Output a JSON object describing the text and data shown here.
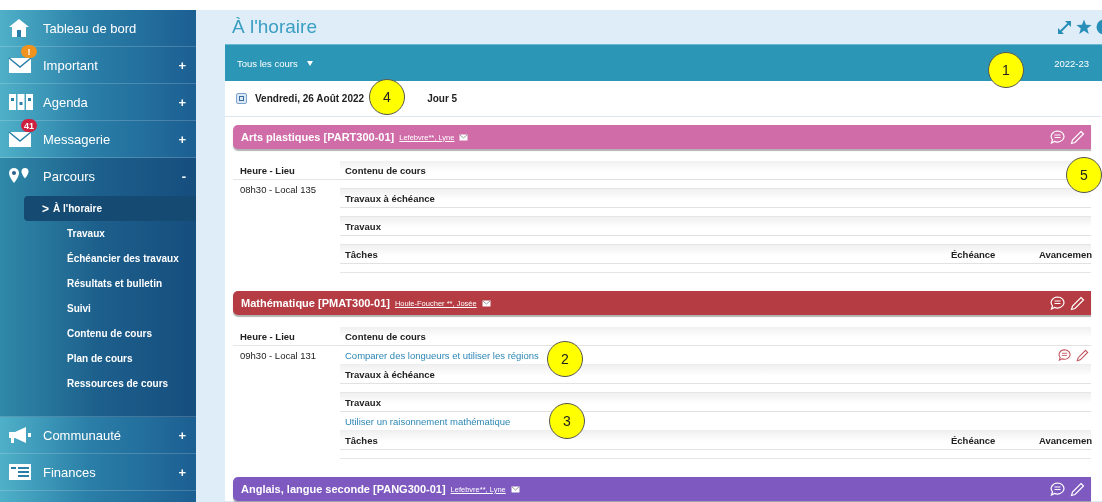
{
  "sidebar": {
    "items": [
      {
        "label": "Tableau de bord"
      },
      {
        "label": "Important",
        "toggle": "+",
        "badge": {
          "text": "!",
          "color": "#f0921e"
        }
      },
      {
        "label": "Agenda",
        "toggle": "+"
      },
      {
        "label": "Messagerie",
        "toggle": "+",
        "badge": {
          "text": "41",
          "color": "#d0203f"
        }
      },
      {
        "label": "Parcours",
        "toggle": "-",
        "expanded": true,
        "children": [
          {
            "label": "À l'horaire",
            "marker": ">",
            "selected": true
          },
          {
            "label": "Travaux",
            "selected": false
          },
          {
            "label": "Échéancier des travaux",
            "selected": false
          },
          {
            "label": "Résultats et bulletin",
            "selected": false
          },
          {
            "label": "Suivi",
            "selected": false
          },
          {
            "label": "Contenu de cours",
            "selected": false
          },
          {
            "label": "Plan de cours",
            "selected": false
          },
          {
            "label": "Ressources de cours",
            "selected": false
          }
        ]
      },
      {
        "label": "Communauté",
        "toggle": "+"
      },
      {
        "label": "Finances",
        "toggle": "+"
      }
    ]
  },
  "page": {
    "title": "À l'horaire"
  },
  "filter_bar": {
    "course_filter": "Tous les cours",
    "year": "2022-23"
  },
  "day": {
    "date": "Vendredi, 26 Août 2022",
    "day_number": "Jour 5"
  },
  "courses": [
    {
      "title": "Arts plastiques [PART300-01]",
      "teacher": "Lefebvre**, Lyne",
      "color": "#d06ca8",
      "time_column": "Heure - Lieu",
      "time_place": "08h30 - Local 135",
      "sections": [
        {
          "label": "Contenu de cours"
        },
        {
          "label": "Travaux à échéance"
        },
        {
          "label": "Travaux"
        },
        {
          "label": "Tâches",
          "kind": "tasks",
          "due_column": "Échéance",
          "progress_column": "Avancemen"
        }
      ]
    },
    {
      "title": "Mathématique [PMAT300-01]",
      "teacher": "Houle-Foucher **, Josée",
      "color": "#b53c42",
      "time_column": "Heure - Lieu",
      "time_place": "09h30 - Local 131",
      "sections": [
        {
          "label": "Contenu de cours",
          "items": [
            {
              "text": "Comparer des longueurs et utiliser les régions",
              "actions": true
            }
          ]
        },
        {
          "label": "Travaux à échéance"
        },
        {
          "label": "Travaux",
          "items": [
            {
              "text": "Utiliser un raisonnement mathématique",
              "actions": false
            }
          ]
        },
        {
          "label": "Tâches",
          "kind": "tasks",
          "due_column": "Échéance",
          "progress_column": "Avancemen"
        }
      ]
    },
    {
      "title": "Anglais, langue seconde [PANG300-01]",
      "teacher": "Lefebvre**, Lyne",
      "color": "#7e59bf"
    }
  ],
  "callouts": [
    {
      "number": "1"
    },
    {
      "number": "2"
    },
    {
      "number": "3"
    },
    {
      "number": "4"
    },
    {
      "number": "5"
    }
  ]
}
